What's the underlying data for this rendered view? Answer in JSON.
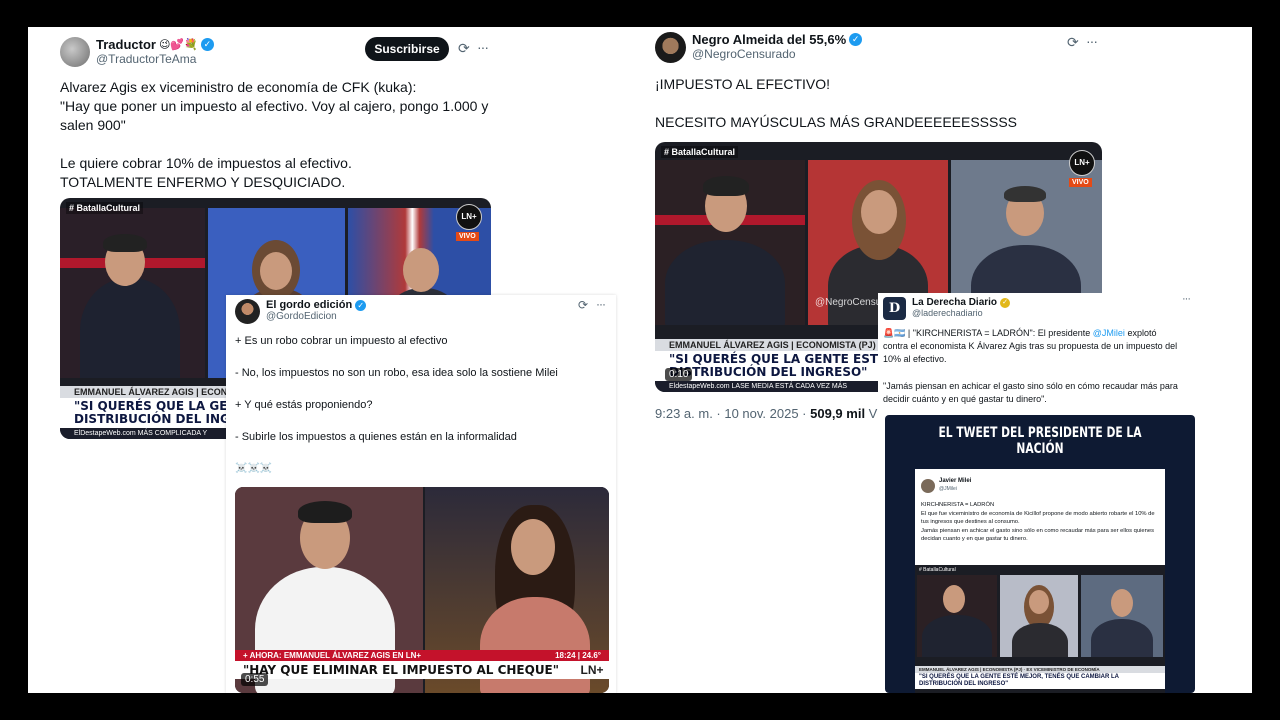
{
  "tweet1": {
    "name": "Traductor",
    "name_emoji": "😉💕💐",
    "handle": "@TraductorTeAma",
    "subscribe_label": "Suscribirse",
    "text": "Alvarez Agis ex viceministro de economía de CFK (kuka):\n\"Hay que poner un impuesto al efectivo. Voy al cajero, pongo 1.000 y salen 900\"\n\nLe quiere cobrar 10% de impuestos al efectivo.\nTOTALMENTE ENFERMO Y DESQUICIADO.",
    "video": {
      "tag": "# BatallaCultural",
      "logo": "LN+",
      "live": "VIVO",
      "lower_name": "EMMANUEL ÁLVAREZ AGIS | ECONO",
      "lower_quote": "\"SI QUERÉS QUE LA GENTE\nDISTRIBUCIÓN DEL INGRESO",
      "lower_sub": "ElDestapeWeb.com   MÁS COMPLICADA Y"
    }
  },
  "tweet2": {
    "name": "Negro Almeida del 55,6%",
    "handle": "@NegroCensurado",
    "text": "¡IMPUESTO AL EFECTIVO!\n\nNECESITO MAYÚSCULAS MÁS GRANDEEEEEESSSSS",
    "timestamp": "9:23 a. m. · 10 nov. 2025 · ",
    "views": "509,9 mil",
    "views_label": " Visual",
    "video": {
      "tag": "# BatallaCultural",
      "logo": "LN+",
      "live": "VIVO",
      "watermark": "@NegroCensurado",
      "lower_name": "EMMANUEL ÁLVAREZ AGIS | ECONOMISTA (PJ)",
      "lower_quote": "\"SI QUERÉS QUE LA GENTE ESTÉ M\nDISTRIBUCIÓN DEL INGRESO\"",
      "lower_sub": "EldestapeWeb.com   LASE MEDIA ESTÁ CADA VEZ MÁS",
      "duration": "0:10"
    }
  },
  "tweet3": {
    "name": "El gordo edición",
    "handle": "@GordoEdicion",
    "lines": [
      "+ Es un robo cobrar un impuesto al efectivo",
      "- No, los impuestos no son un robo, esa idea solo la sostiene Milei",
      "+ Y qué estás proponiendo?",
      "- Subirle los impuestos a quienes están en la informalidad",
      "☠️☠️☠️"
    ],
    "video": {
      "lower_name": "+  AHORA: EMMANUEL ÁLVAREZ AGIS EN LN+",
      "lower_time": "18:24 | 24.6°",
      "lower_quote": "\"HAY QUE ELIMINAR EL IMPUESTO AL CHEQUE\"",
      "logo": "LN+",
      "duration": "0:55"
    }
  },
  "tweet4": {
    "name": "La Derecha Diario",
    "handle": "@laderechadiario",
    "text_prefix": "🚨🇦🇷 | \"KIRCHNERISTA = LADRÓN\": El presidente ",
    "mention": "@JMilei",
    "text_suffix": " explotó contra el economista K Álvarez Agis tras su propuesta de un impuesto del 10% al efectivo.",
    "quote": "\"Jamás piensan en achicar el gasto sino sólo en cómo recaudar más para decidir cuánto y en qué gastar tu dinero\".",
    "image": {
      "banner": "EL TWEET DEL PRESIDENTE DE LA NACIÓN",
      "inner_name": "Javier Milei",
      "inner_handle": "@JMilei",
      "inner_text": "KIRCHNERISTA = LADRÓN\nEl que fue viceministro de economía de Kicillof propone de modo abierto robarte el 10% de tus ingresos que destines al consumo.\nJamás piensan en achicar el gasto sino sólo en como recaudar más para ser ellos quienes decidan cuanto y en que gastar tu dinero.",
      "tag": "# BatallaCultural",
      "lower_name": "EMMANUEL ÁLVAREZ AGIS | ECONOMISTA (PJ) · EX VICEMINISTRO DE ECONOMÍA",
      "lower_quote": "\"SI QUERÉS QUE LA GENTE ESTÉ MEJOR, TENÉS QUE CAMBIAR LA\nDISTRIBUCIÓN DEL INGRESO\""
    }
  },
  "icons": {
    "grok": "⟳",
    "more": "···",
    "verified": "✓"
  }
}
